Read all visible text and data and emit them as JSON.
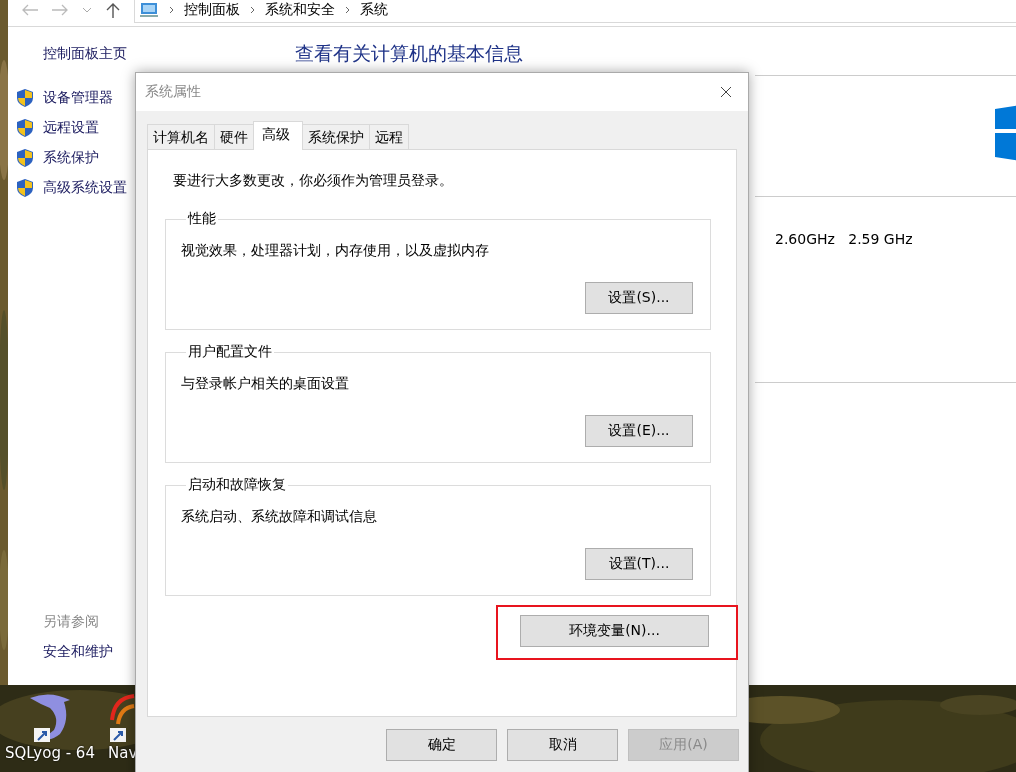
{
  "desktop": {
    "icons": [
      {
        "label": "SQLyog - 64",
        "kind": "dolphin"
      },
      {
        "label": "Nav",
        "kind": "rings"
      }
    ]
  },
  "explorer": {
    "breadcrumbs": [
      "控制面板",
      "系统和安全",
      "系统"
    ],
    "sidebar": {
      "home": "控制面板主页",
      "links": [
        "设备管理器",
        "远程设置",
        "系统保护",
        "高级系统设置"
      ]
    },
    "see_also": {
      "title": "另请参阅",
      "links": [
        "安全和维护"
      ]
    },
    "heading": "查看有关计算机的基本信息",
    "processor_speed": "2.60GHz   2.59 GHz"
  },
  "dialog": {
    "title": "系统属性",
    "tabs": [
      {
        "label": "计算机名",
        "selected": false
      },
      {
        "label": "硬件",
        "selected": false
      },
      {
        "label": "高级",
        "selected": true
      },
      {
        "label": "系统保护",
        "selected": false
      },
      {
        "label": "远程",
        "selected": false
      }
    ],
    "notice": "要进行大多数更改，你必须作为管理员登录。",
    "groups": [
      {
        "title": "性能",
        "description": "视觉效果，处理器计划，内存使用，以及虚拟内存",
        "button": "设置(S)..."
      },
      {
        "title": "用户配置文件",
        "description": "与登录帐户相关的桌面设置",
        "button": "设置(E)..."
      },
      {
        "title": "启动和故障恢复",
        "description": "系统启动、系统故障和调试信息",
        "button": "设置(T)..."
      }
    ],
    "env_button": {
      "label": "环境变量(N)...",
      "highlighted": true
    },
    "buttons": [
      {
        "label": "确定",
        "disabled": false
      },
      {
        "label": "取消",
        "disabled": false
      },
      {
        "label": "应用(A)",
        "disabled": true
      }
    ]
  }
}
